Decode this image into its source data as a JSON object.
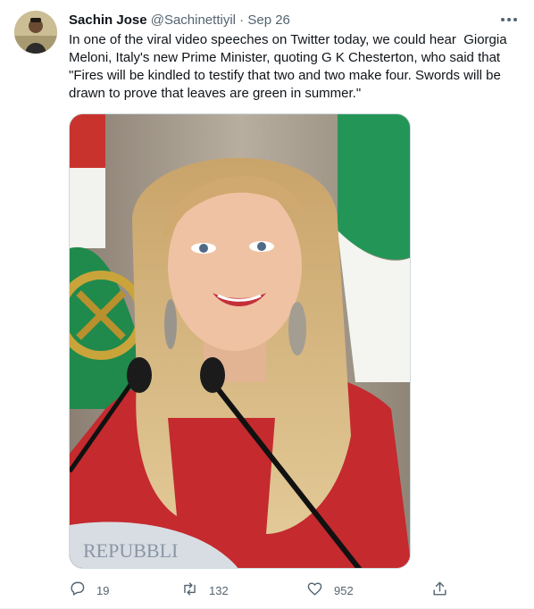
{
  "tweet": {
    "display_name": "Sachin Jose",
    "handle": "@Sachinettiyil",
    "separator": "·",
    "time": "Sep 26",
    "text": "In one of the viral video speeches on Twitter today, we could hear  Giorgia Meloni, Italy's new Prime Minister, quoting G K Chesterton, who said that \"Fires will be kindled to testify that two and two make four. Swords will be drawn to prove that leaves are green in summer.\"",
    "media_caption_text": "REPUBBLI",
    "actions": {
      "reply_count": "19",
      "retweet_count": "132",
      "like_count": "952"
    },
    "icons": [
      "more-icon",
      "reply-icon",
      "retweet-icon",
      "like-icon",
      "share-icon"
    ]
  },
  "colors": {
    "text": "#0f1419",
    "secondary": "#536471",
    "border": "#cfd9de"
  }
}
